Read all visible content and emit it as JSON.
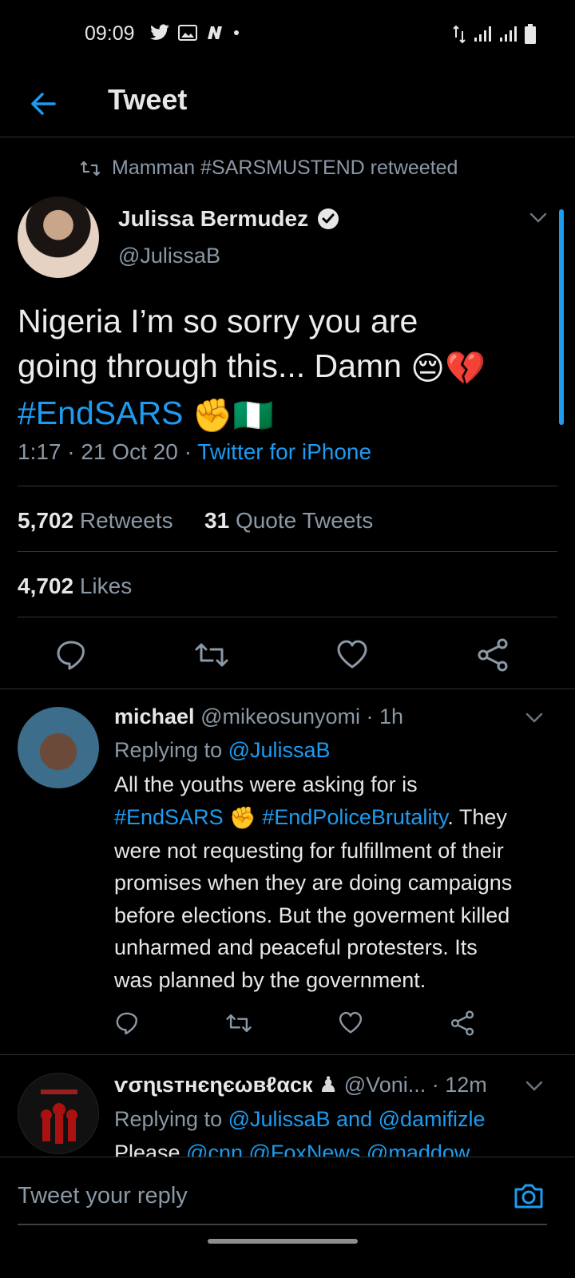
{
  "status_bar": {
    "time": "09:09",
    "icons": [
      "twitter-bird-icon",
      "gallery-icon",
      "n-icon",
      "dot-icon"
    ],
    "right_icons": [
      "data-arrows-icon",
      "signal-icon",
      "signal-icon-2",
      "battery-icon"
    ]
  },
  "header": {
    "back_icon": "arrow-left-icon",
    "title": "Tweet"
  },
  "retweet_context": {
    "icon": "retweet-icon",
    "text": "Mamman #SARSMUSTEND retweeted"
  },
  "tweet": {
    "author_name": "Julissa Bermudez",
    "verified": true,
    "author_handle": "@JulissaB",
    "text_line1": "Nigeria I’m so sorry you are",
    "text_line2": "going through this... Damn ",
    "emoji_1": "😔💔",
    "hashtag": "#EndSARS",
    "emoji_2": "✊🇳🇬",
    "time": "1:17 · 21 Oct 20 · ",
    "source": "Twitter for iPhone",
    "retweets_count": "5,702",
    "retweets_label": "Retweets",
    "quote_count": "31",
    "quote_label": "Quote Tweets",
    "likes_count": "4,702",
    "likes_label": "Likes"
  },
  "replies": [
    {
      "name": "michael",
      "handle_time": "@mikeosunyomi · 1h",
      "replying_to_label": "Replying to ",
      "replying_to": "@JulissaB",
      "text_1": "All the youths were asking for is",
      "hashtag_1": "#EndSARS",
      "emoji": "✊",
      "hashtag_2": "#EndPoliceBrutality",
      "text_2": ". They",
      "text_3": "were not requesting for fulfillment of their",
      "text_4": "promises when they are doing campaigns",
      "text_5": "before elections. But the goverment killed",
      "text_6": "unharmed and peaceful protesters. Its",
      "text_7": "was planned by the government."
    },
    {
      "name": "ѵσɳɩsтнєɳєωвℓαcк",
      "emoji": "♟",
      "handle": "@Voni...",
      "time": " · 12m",
      "replying_to_label": "Replying to ",
      "replying_to": "@JulissaB and @damifizle",
      "text_partial_1": "Please ",
      "text_partial_2": "@cnn @FoxNews @maddow"
    }
  ],
  "reply_composer": {
    "placeholder": "Tweet your reply",
    "camera_icon": "camera-icon"
  },
  "colors": {
    "accent": "#1d9bf0",
    "muted": "#8b98a5",
    "background": "#000000"
  }
}
